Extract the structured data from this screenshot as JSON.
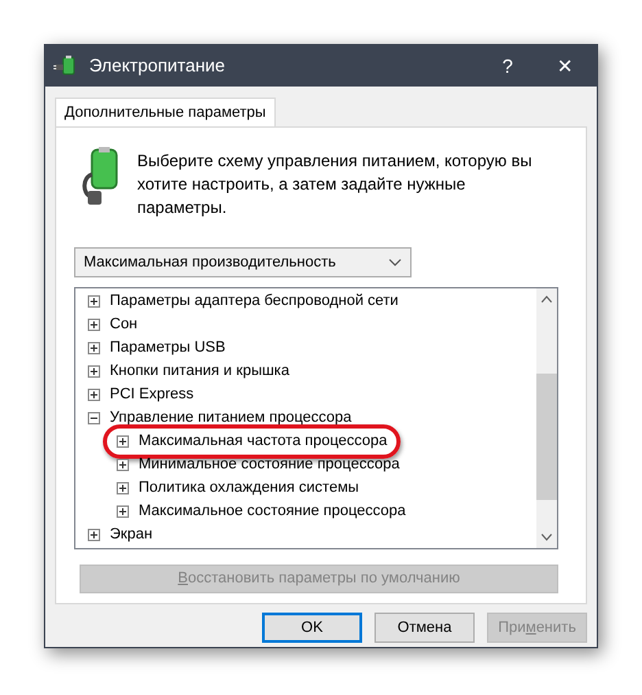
{
  "window": {
    "title": "Электропитание",
    "help": "?",
    "close": "✕"
  },
  "tabs": [
    {
      "label": "Дополнительные параметры",
      "selected": true
    }
  ],
  "intro": "Выберите схему управления питанием, которую вы хотите настроить, а затем задайте нужные параметры.",
  "plan_dropdown": {
    "value": "Максимальная производительность"
  },
  "tree": [
    {
      "label": "Параметры адаптера беспроводной сети",
      "expanded": false,
      "highlighted": false
    },
    {
      "label": "Сон",
      "expanded": false,
      "highlighted": false
    },
    {
      "label": "Параметры USB",
      "expanded": false,
      "highlighted": false
    },
    {
      "label": "Кнопки питания и крышка",
      "expanded": false,
      "highlighted": false
    },
    {
      "label": "PCI Express",
      "expanded": false,
      "highlighted": false
    },
    {
      "label": "Управление питанием процессора",
      "expanded": true,
      "highlighted": false,
      "children": [
        {
          "label": "Максимальная частота процессора",
          "expanded": false,
          "highlighted": true
        },
        {
          "label": "Минимальное состояние процессора",
          "expanded": false,
          "highlighted": false
        },
        {
          "label": "Политика охлаждения системы",
          "expanded": false,
          "highlighted": false
        },
        {
          "label": "Максимальное состояние процессора",
          "expanded": false,
          "highlighted": false
        }
      ]
    },
    {
      "label": "Экран",
      "expanded": false,
      "highlighted": false
    }
  ],
  "restore_button": {
    "key": "В",
    "after": "осстановить параметры по умолчанию",
    "disabled": true
  },
  "buttons": [
    {
      "before": "OK",
      "default": true,
      "disabled": false
    },
    {
      "before": "Отмена",
      "default": false,
      "disabled": false
    },
    {
      "before": "При",
      "key": "м",
      "after": "енить",
      "default": false,
      "disabled": true
    }
  ]
}
